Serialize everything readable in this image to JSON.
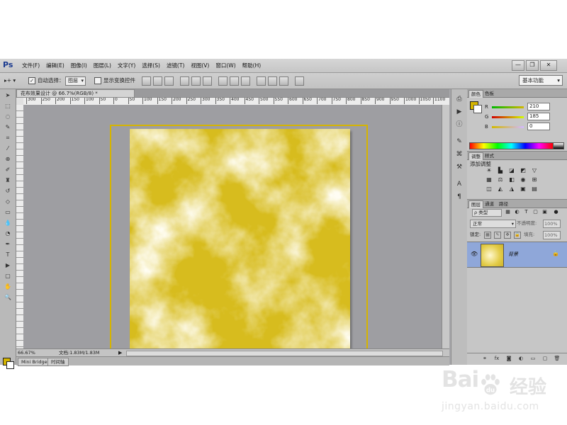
{
  "app": {
    "logo": "Ps"
  },
  "menu": [
    "文件(F)",
    "编辑(E)",
    "图像(I)",
    "图层(L)",
    "文字(Y)",
    "选择(S)",
    "滤镜(T)",
    "视图(V)",
    "窗口(W)",
    "帮助(H)"
  ],
  "window_buttons": {
    "minimize": "—",
    "restore": "❐",
    "close": "✕"
  },
  "options": {
    "auto_select_label": "自动选择：",
    "auto_select_value": "图层",
    "transform_label": "显示变换控件",
    "workspace": "基本功能"
  },
  "document": {
    "tab_title": "花布效果设计 @ 66.7%(RGB/8) *",
    "zoom": "66.67%",
    "doc_size": "文档:1.83M/1.83M"
  },
  "ruler_ticks": [
    "300",
    "250",
    "200",
    "150",
    "100",
    "50",
    "0",
    "50",
    "100",
    "150",
    "200",
    "250",
    "300",
    "350",
    "400",
    "450",
    "500",
    "550",
    "600",
    "650",
    "700",
    "750",
    "800",
    "850",
    "900",
    "950",
    "1000",
    "1050",
    "1100"
  ],
  "bottom_tabs": [
    "Mini Bridge",
    "时间轴"
  ],
  "color_panel": {
    "tabs": [
      "颜色",
      "色板"
    ],
    "r": "210",
    "g": "185",
    "b": "0",
    "fg_color": "#d4b400",
    "bg_color": "#ffffff"
  },
  "adjust_panel": {
    "tabs": [
      "调整",
      "样式"
    ],
    "title": "添加调整"
  },
  "layers_panel": {
    "tabs": [
      "图层",
      "通道",
      "路径"
    ],
    "kind": "ρ 类型",
    "blend": "正常",
    "opacity_label": "不透明度:",
    "opacity": "100%",
    "lock_label": "锁定:",
    "fill_label": "填充:",
    "fill": "100%",
    "layer_name": "背景"
  },
  "canvas": {
    "base_color": "#d7bc1e",
    "cloud_color": "#fffbe6",
    "guide_color": "#d6b400"
  },
  "watermark": {
    "text": "Bai",
    "text2": "经验",
    "text_mid": "du",
    "url": "jingyan.baidu.com"
  }
}
